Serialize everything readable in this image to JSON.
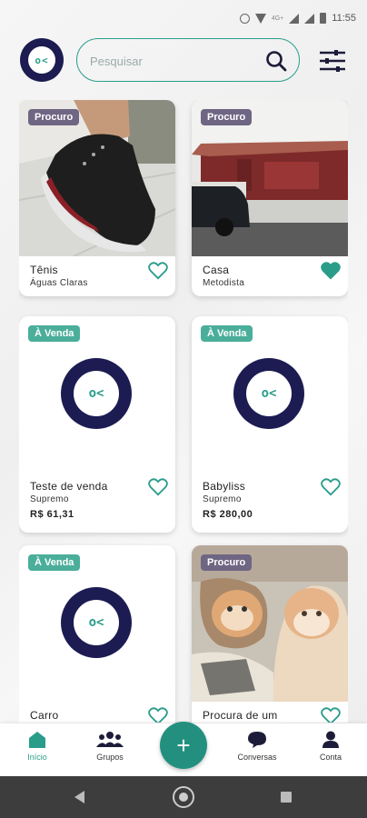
{
  "status_bar": {
    "time": "11:55",
    "network": "4G+"
  },
  "search": {
    "placeholder": "Pesquisar"
  },
  "colors": {
    "accent": "#2a9d8a",
    "navy": "#1c1c52",
    "badge_procuro": "#6f6684",
    "badge_venda": "#4aae9b"
  },
  "logo": {
    "text": "o<"
  },
  "cards": [
    {
      "badge": "Procuro",
      "badge_type": "procuro",
      "title": "Tênis",
      "subtitle": "Águas Claras",
      "price": "",
      "favorited": false,
      "image": "sneaker-photo"
    },
    {
      "badge": "Procuro",
      "badge_type": "procuro",
      "title": "Casa",
      "subtitle": "Metodista",
      "price": "",
      "favorited": true,
      "image": "house-photo"
    },
    {
      "badge": "À Venda",
      "badge_type": "venda",
      "title": "Teste de venda",
      "subtitle": "Supremo",
      "price": "R$ 61,31",
      "favorited": false,
      "image": "placeholder-logo"
    },
    {
      "badge": "À Venda",
      "badge_type": "venda",
      "title": "Babyliss",
      "subtitle": "Supremo",
      "price": "R$ 280,00",
      "favorited": false,
      "image": "placeholder-logo"
    },
    {
      "badge": "À Venda",
      "badge_type": "venda",
      "title": "Carro",
      "subtitle": "",
      "price": "",
      "favorited": false,
      "image": "placeholder-logo"
    },
    {
      "badge": "Procuro",
      "badge_type": "procuro",
      "title": "Procura de um",
      "subtitle": "",
      "price": "",
      "favorited": false,
      "image": "cats-photo"
    }
  ],
  "nav": {
    "home": "Início",
    "groups": "Grupos",
    "add": "+",
    "chats": "Conversas",
    "account": "Conta"
  }
}
